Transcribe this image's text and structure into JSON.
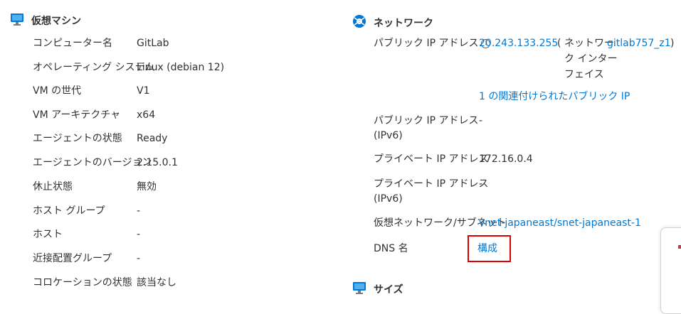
{
  "vm_section": {
    "title": "仮想マシン",
    "icon": "monitor-icon",
    "rows": [
      {
        "label": "コンピューター名",
        "value": "GitLab"
      },
      {
        "label": "オペレーティング システム",
        "value": "Linux (debian 12)"
      },
      {
        "label": "VM の世代",
        "value": "V1"
      },
      {
        "label": "VM アーキテクチャ",
        "value": "x64"
      },
      {
        "label": "エージェントの状態",
        "value": "Ready"
      },
      {
        "label": "エージェントのバージョン",
        "value": "2.15.0.1"
      },
      {
        "label": "休止状態",
        "value": "無効"
      },
      {
        "label": "ホスト グループ",
        "value": "-"
      },
      {
        "label": "ホスト",
        "value": "-"
      },
      {
        "label": "近接配置グループ",
        "value": "-"
      },
      {
        "label": "コロケーションの状態",
        "value": "該当なし"
      }
    ]
  },
  "network_section": {
    "title": "ネットワーク",
    "icon": "network-icon",
    "public_ip_label": "パブリック IP アドレス",
    "public_ip_value": "20.243.133.255",
    "paren_open": "(",
    "nic_label_line1": "ネットワー",
    "nic_label_line2": "ク インター",
    "nic_label_line3": "フェイス",
    "nic_link": "gitlab757_z1",
    "paren_close": ")",
    "associated_ip_link": "1 の関連付けられたパブリック IP",
    "public_ipv6_label_line1": "パブリック IP アドレス",
    "public_ipv6_label_line2": "(IPv6)",
    "public_ipv6_value": "-",
    "private_ip_label": "プライベート IP アドレス",
    "private_ip_value": "172.16.0.4",
    "private_ipv6_label_line1": "プライベート IP アドレス",
    "private_ipv6_label_line2": "(IPv6)",
    "private_ipv6_value": "-",
    "vnet_label": "仮想ネットワーク/サブネット",
    "vnet_link": "vnet-japaneast/snet-japaneast-1",
    "dns_label": "DNS 名",
    "dns_link": "構成"
  },
  "size_section": {
    "title": "サイズ",
    "icon": "size-icon"
  },
  "colors": {
    "link": "#0078d4",
    "highlight_box": "#e00000",
    "text": "#323130"
  }
}
